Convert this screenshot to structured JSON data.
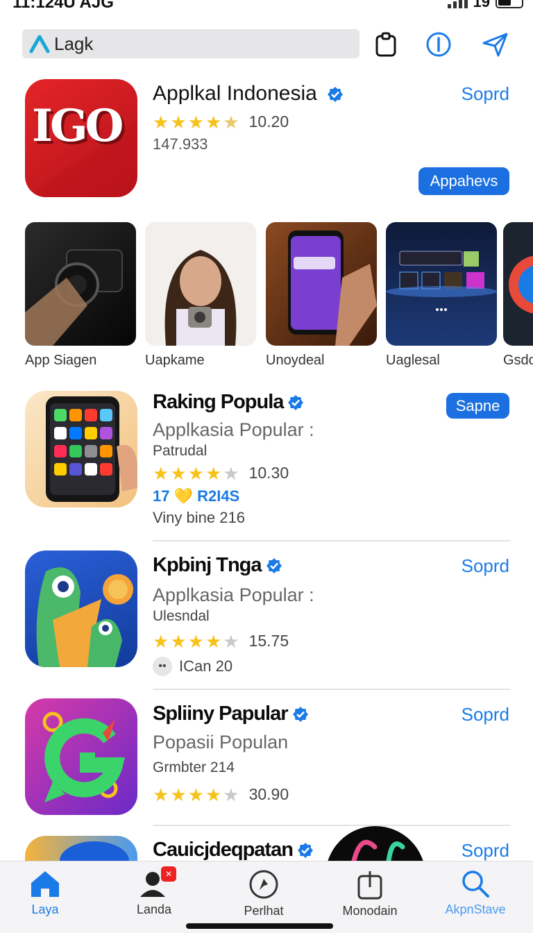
{
  "status": {
    "time": "11:124U AJG",
    "battery": "19"
  },
  "search": {
    "value": "Lagk"
  },
  "featured": {
    "title": "Applkal Indonesia",
    "rating": "10.20",
    "count": "147.933",
    "action_link": "Soprd",
    "action_button": "Appahevs"
  },
  "gallery": [
    {
      "label": "App Siagen"
    },
    {
      "label": "Uapkame"
    },
    {
      "label": "Unoydeal"
    },
    {
      "label": "Uaglesal"
    },
    {
      "label": "Gsdc"
    }
  ],
  "list": [
    {
      "title": "Raking Popula",
      "subtitle": "Applkasia Popular :",
      "category": "Patrudal",
      "rating": "10.30",
      "extra": "17 💛 R2I4S",
      "extra2": "Viny bine 216",
      "action": "Sapne"
    },
    {
      "title": "Kpbinj Tnga",
      "subtitle": "Applkasia Popular :",
      "category": "Ulesndal",
      "rating": "15.75",
      "extra": "ICan 20",
      "action": "Soprd"
    },
    {
      "title": "Spliiny Papular",
      "subtitle": "Popasii Populan",
      "category": "Grmbter 214",
      "rating": "30.90",
      "action": "Soprd"
    },
    {
      "title": "Cauicjdeqpatan",
      "action": "Soprd"
    }
  ],
  "tabs": [
    {
      "label": "Laya"
    },
    {
      "label": "Landa"
    },
    {
      "label": "Perlhat"
    },
    {
      "label": "Monodain"
    },
    {
      "label": "AkpnStave"
    }
  ],
  "colors": {
    "accent": "#1b7be6",
    "star": "#f6c21c",
    "featured_icon": "#e42428"
  }
}
